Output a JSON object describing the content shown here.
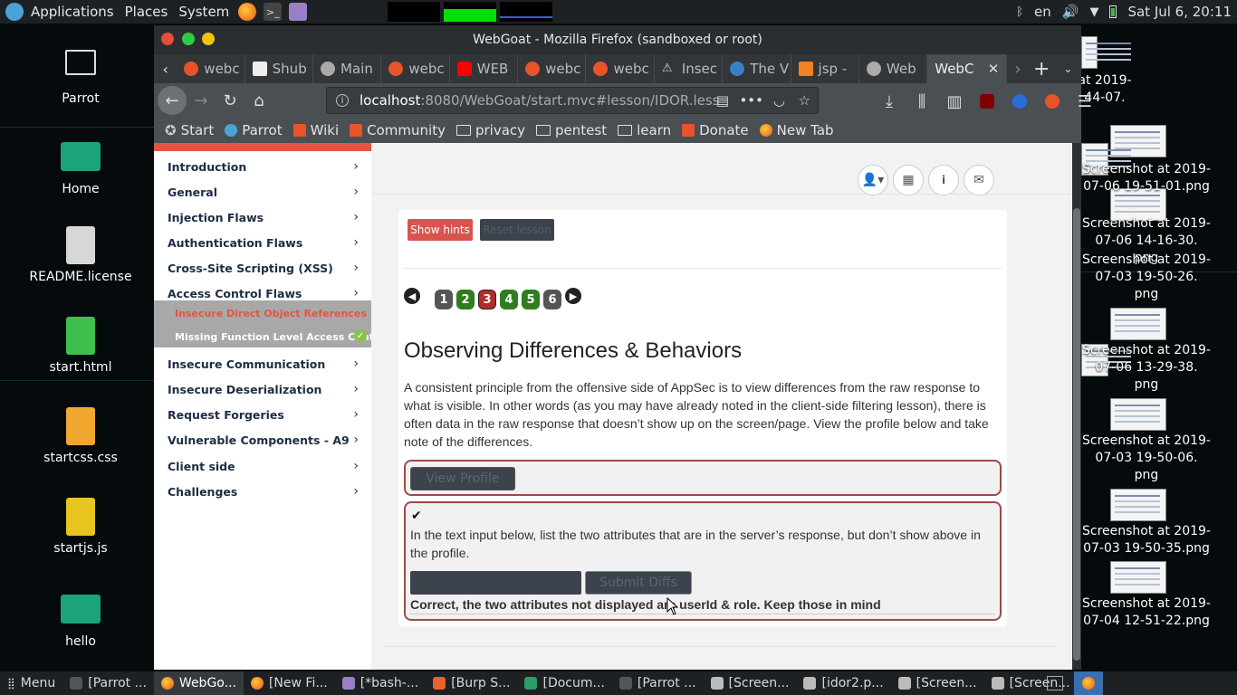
{
  "top_panel": {
    "applications": "Applications",
    "places": "Places",
    "system": "System",
    "keyboard_layout": "en",
    "datetime": "Sat Jul 6, 20:11"
  },
  "desktop": {
    "icons": [
      {
        "label": "Parrot"
      },
      {
        "label": "Home"
      },
      {
        "label": "README.license"
      },
      {
        "label": "start.html"
      },
      {
        "label": "startcss.css"
      },
      {
        "label": "startjs.js"
      },
      {
        "label": "hello"
      }
    ],
    "right_files": [
      "at 2019-\n44-07.",
      "Screenshot at 2019-\n07-06 19-51-01.png",
      "at 2019-\n-40-58.",
      "Screenshot at 2019-\n07-06 14-16-30.\npng",
      "Screenshot at 2019-\n07-03 19-50-26.\npng",
      "r.png",
      "Screenshot at 2019-\n07-06 13-29-38.\npng",
      "Screenshot at 2019-\n07-03 19-50-06.\npng",
      "Screenshot at 2019-\n07-03 19-50-35.png",
      "Screenshot at 2019-\n07-04 12-51-22.png"
    ]
  },
  "firefox": {
    "window_title": "WebGoat - Mozilla Firefox (sandboxed or root)",
    "tabs": [
      {
        "label": "webc",
        "color": "#e8532a"
      },
      {
        "label": "Shub",
        "color": "#eeeeee"
      },
      {
        "label": "Main",
        "color": "#aaaaaa"
      },
      {
        "label": "webc",
        "color": "#e8532a"
      },
      {
        "label": "WEB",
        "color": "#ff0000"
      },
      {
        "label": "webc",
        "color": "#e8532a"
      },
      {
        "label": "webc",
        "color": "#e8532a"
      },
      {
        "label": "Insec",
        "color": "#cccccc"
      },
      {
        "label": "The V",
        "color": "#3b7fc4"
      },
      {
        "label": "jsp -",
        "color": "#f48024"
      },
      {
        "label": "Web",
        "color": "#aaaaaa"
      },
      {
        "label": "WebC",
        "color": "#e8532a",
        "active": true
      }
    ],
    "url_host": "localhost",
    "url_rest": ":8080/WebGoat/start.mvc#lesson/IDOR.less",
    "bookmarks": [
      {
        "label": "Start",
        "type": "star"
      },
      {
        "label": "Parrot",
        "type": "parrot"
      },
      {
        "label": "Wiki",
        "type": "wiki"
      },
      {
        "label": "Community",
        "type": "wiki"
      },
      {
        "label": "privacy",
        "type": "folder"
      },
      {
        "label": "pentest",
        "type": "folder"
      },
      {
        "label": "learn",
        "type": "folder"
      },
      {
        "label": "Donate",
        "type": "wiki"
      },
      {
        "label": "New Tab",
        "type": "firefox"
      }
    ]
  },
  "webgoat": {
    "menu": [
      "Introduction",
      "General",
      "Injection Flaws",
      "Authentication Flaws",
      "Cross-Site Scripting (XSS)",
      "Access Control Flaws",
      "Insecure Communication",
      "Insecure Deserialization",
      "Request Forgeries",
      "Vulnerable Components - A9",
      "Client side",
      "Challenges"
    ],
    "submenu": [
      "Insecure Direct Object References",
      "Missing Function Level Access Control"
    ],
    "buttons": {
      "show_hints": "Show hints",
      "reset_lesson": "Reset lesson"
    },
    "pages": [
      "1",
      "2",
      "3",
      "4",
      "5",
      "6"
    ],
    "lesson_title": "Observing Differences & Behaviors",
    "lesson_text": "A consistent principle from the offensive side of AppSec is to view differences from the raw response to what is visible. In other words (as you may have already noted in the client-side filtering lesson), there is often data in the raw response that doesn’t show up on the screen/page. View the profile below and take note of the differences.",
    "view_profile": "View Profile",
    "checkmark": "✔",
    "instruction": "In the text input below, list the two attributes that are in the server’s response, but don’t show above in the profile.",
    "submit": "Submit Diffs",
    "feedback": "Correct, the two attributes not displayed are userId & role. Keep those in mind"
  },
  "taskbar": {
    "menu": "Menu",
    "items": [
      {
        "label": "[Parrot ...",
        "active": false
      },
      {
        "label": "WebGo...",
        "active": true
      },
      {
        "label": "[New Fi...",
        "active": false
      },
      {
        "label": "[*bash-...",
        "active": false
      },
      {
        "label": "[Burp S...",
        "active": false
      },
      {
        "label": "[Docum...",
        "active": false
      },
      {
        "label": "[Parrot ...",
        "active": false
      },
      {
        "label": "[Screen...",
        "active": false
      },
      {
        "label": "[idor2.p...",
        "active": false
      },
      {
        "label": "[Screen...",
        "active": false
      },
      {
        "label": "[Screen...",
        "active": false
      }
    ]
  }
}
